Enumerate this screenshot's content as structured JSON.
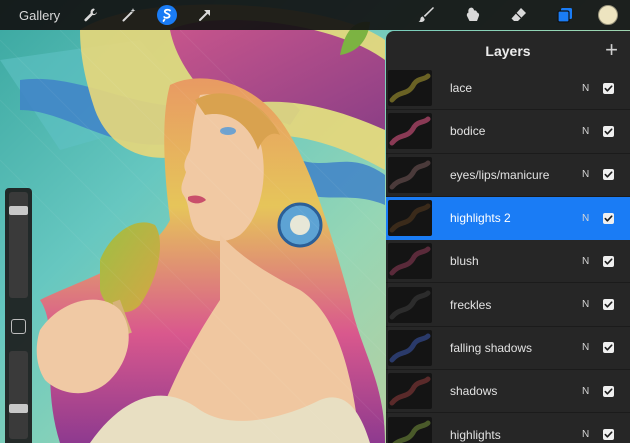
{
  "toolbar": {
    "gallery_label": "Gallery",
    "icons": [
      "wrench-icon",
      "magic-wand-icon",
      "selection-icon",
      "transform-arrow-icon",
      "brush-icon",
      "smudge-icon",
      "eraser-icon",
      "layers-icon",
      "color-swatch"
    ],
    "active_tool": "selection-icon",
    "accent_color": "#1a7cf5",
    "current_color": "#ede4c0"
  },
  "layers_panel": {
    "title": "Layers",
    "add_label": "+",
    "selected_color": "#1a7cf5",
    "layers": [
      {
        "name": "lace",
        "blend": "N",
        "visible": true,
        "selected": false
      },
      {
        "name": "bodice",
        "blend": "N",
        "visible": true,
        "selected": false
      },
      {
        "name": "eyes/lips/manicure",
        "blend": "N",
        "visible": true,
        "selected": false
      },
      {
        "name": "highlights 2",
        "blend": "N",
        "visible": true,
        "selected": true
      },
      {
        "name": "blush",
        "blend": "N",
        "visible": true,
        "selected": false
      },
      {
        "name": "freckles",
        "blend": "N",
        "visible": true,
        "selected": false
      },
      {
        "name": "falling shadows",
        "blend": "N",
        "visible": true,
        "selected": false
      },
      {
        "name": "shadows",
        "blend": "N",
        "visible": true,
        "selected": false
      },
      {
        "name": "highlights",
        "blend": "N",
        "visible": true,
        "selected": false
      }
    ]
  },
  "sidebar": {
    "icons": [
      "brush-size-slider",
      "modify-button-icon",
      "opacity-slider"
    ]
  }
}
